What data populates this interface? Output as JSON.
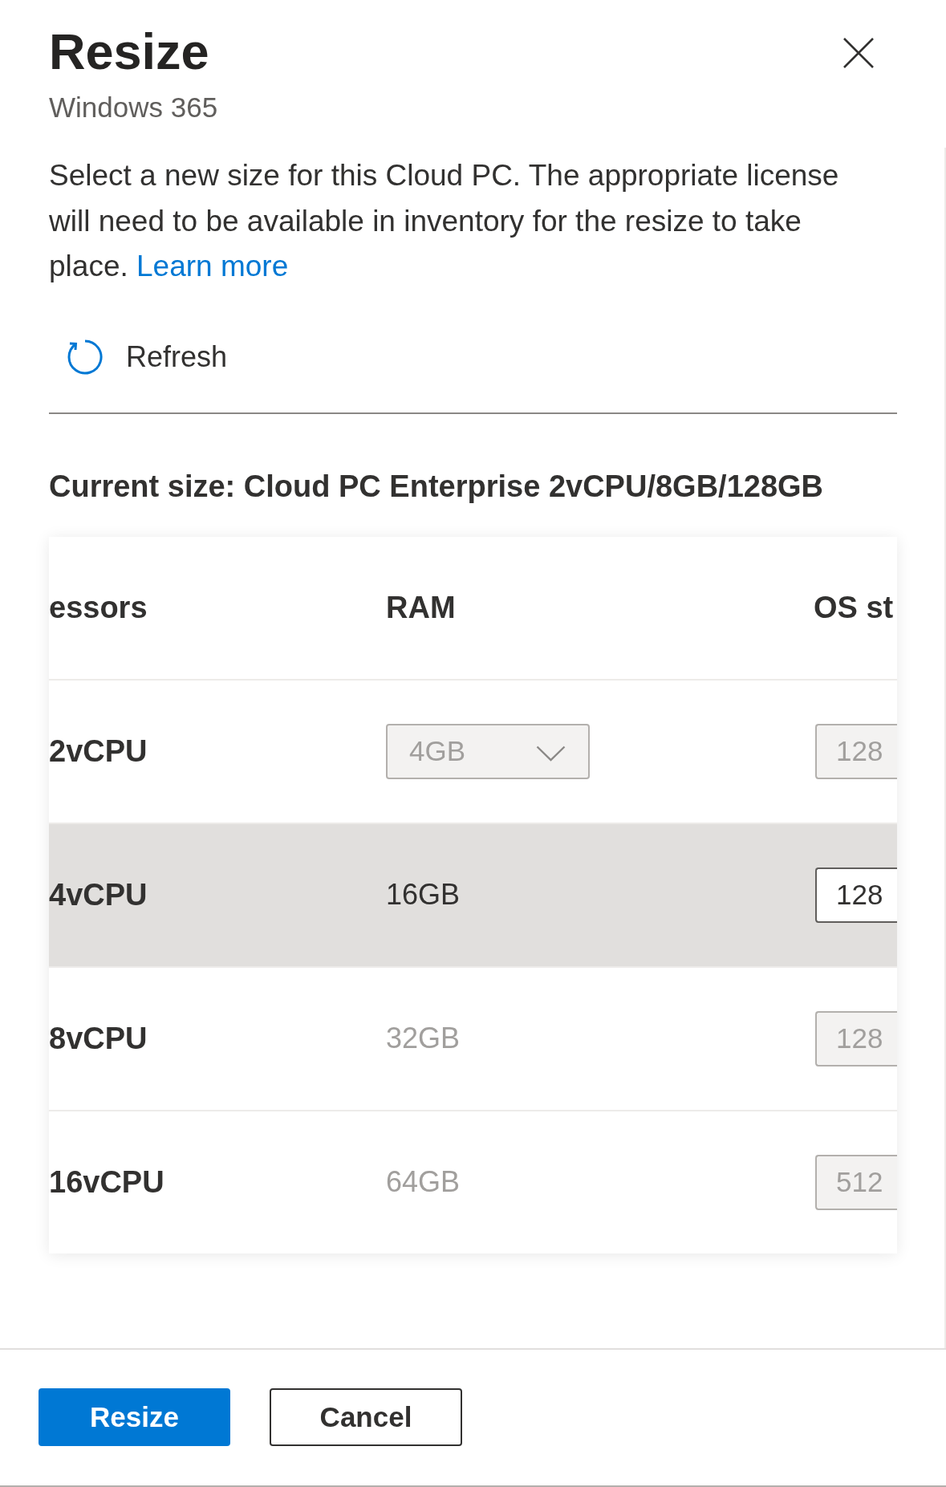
{
  "panel": {
    "title": "Resize",
    "subtitle": "Windows 365"
  },
  "description": {
    "text": "Select a new size for this Cloud PC. The appropriate license will need to be available in inventory for the resize to take place.",
    "link": "Learn more"
  },
  "toolbar": {
    "refresh_label": "Refresh"
  },
  "current_size": "Current size: Cloud PC Enterprise 2vCPU/8GB/128GB",
  "table": {
    "columns": [
      "essors",
      "RAM",
      "OS st"
    ],
    "rows": [
      {
        "processors": "2vCPU",
        "ram": {
          "kind": "dropdown",
          "value": "4GB"
        },
        "os_storage": "128",
        "disabled": true,
        "selected": false
      },
      {
        "processors": "4vCPU",
        "ram": {
          "kind": "text",
          "value": "16GB"
        },
        "os_storage": "128",
        "disabled": false,
        "selected": true
      },
      {
        "processors": "8vCPU",
        "ram": {
          "kind": "text",
          "value": "32GB"
        },
        "os_storage": "128",
        "disabled": true,
        "selected": false
      },
      {
        "processors": "16vCPU",
        "ram": {
          "kind": "text",
          "value": "64GB"
        },
        "os_storage": "512",
        "disabled": true,
        "selected": false
      }
    ]
  },
  "buttons": [
    {
      "label": "Resize",
      "kind": "primary"
    },
    {
      "label": "Cancel",
      "kind": "secondary"
    }
  ]
}
